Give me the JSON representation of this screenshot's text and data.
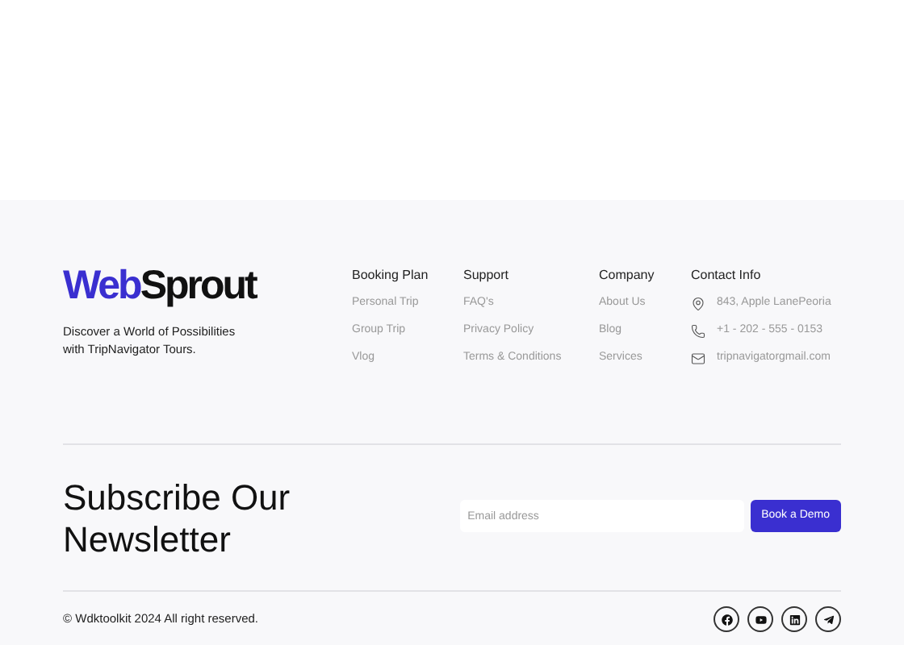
{
  "logo": {
    "parts": [
      {
        "text": "Web",
        "kind": "accent"
      },
      {
        "text": "Sprout",
        "kind": "plain"
      }
    ]
  },
  "tagline": "Discover a World of Possibilities with TripNavigator Tours.",
  "columns": [
    {
      "title": "Booking Plan",
      "links": [
        "Personal Trip",
        "Group Trip",
        "Vlog"
      ]
    },
    {
      "title": "Support",
      "links": [
        "FAQ's",
        "Privacy Policy",
        "Terms & Conditions"
      ]
    },
    {
      "title": "Company",
      "links": [
        "About Us",
        "Blog",
        "Services"
      ]
    }
  ],
  "contact": {
    "title": "Contact Info",
    "items": [
      {
        "kind": "address",
        "text": "843, Apple LanePeoria"
      },
      {
        "kind": "phone",
        "text": "+1 - 202 - 555 - 0153"
      },
      {
        "kind": "email",
        "text": "tripnavigatorgmail.com"
      }
    ]
  },
  "newsletter": {
    "title": "Subscribe Our Newsletter",
    "placeholder": "Email address",
    "button": "Book a Demo"
  },
  "copyright": "© Wdktoolkit 2024 All right reserved.",
  "social": [
    {
      "kind": "facebook"
    },
    {
      "kind": "youtube"
    },
    {
      "kind": "linkedin"
    },
    {
      "kind": "telegram"
    }
  ]
}
